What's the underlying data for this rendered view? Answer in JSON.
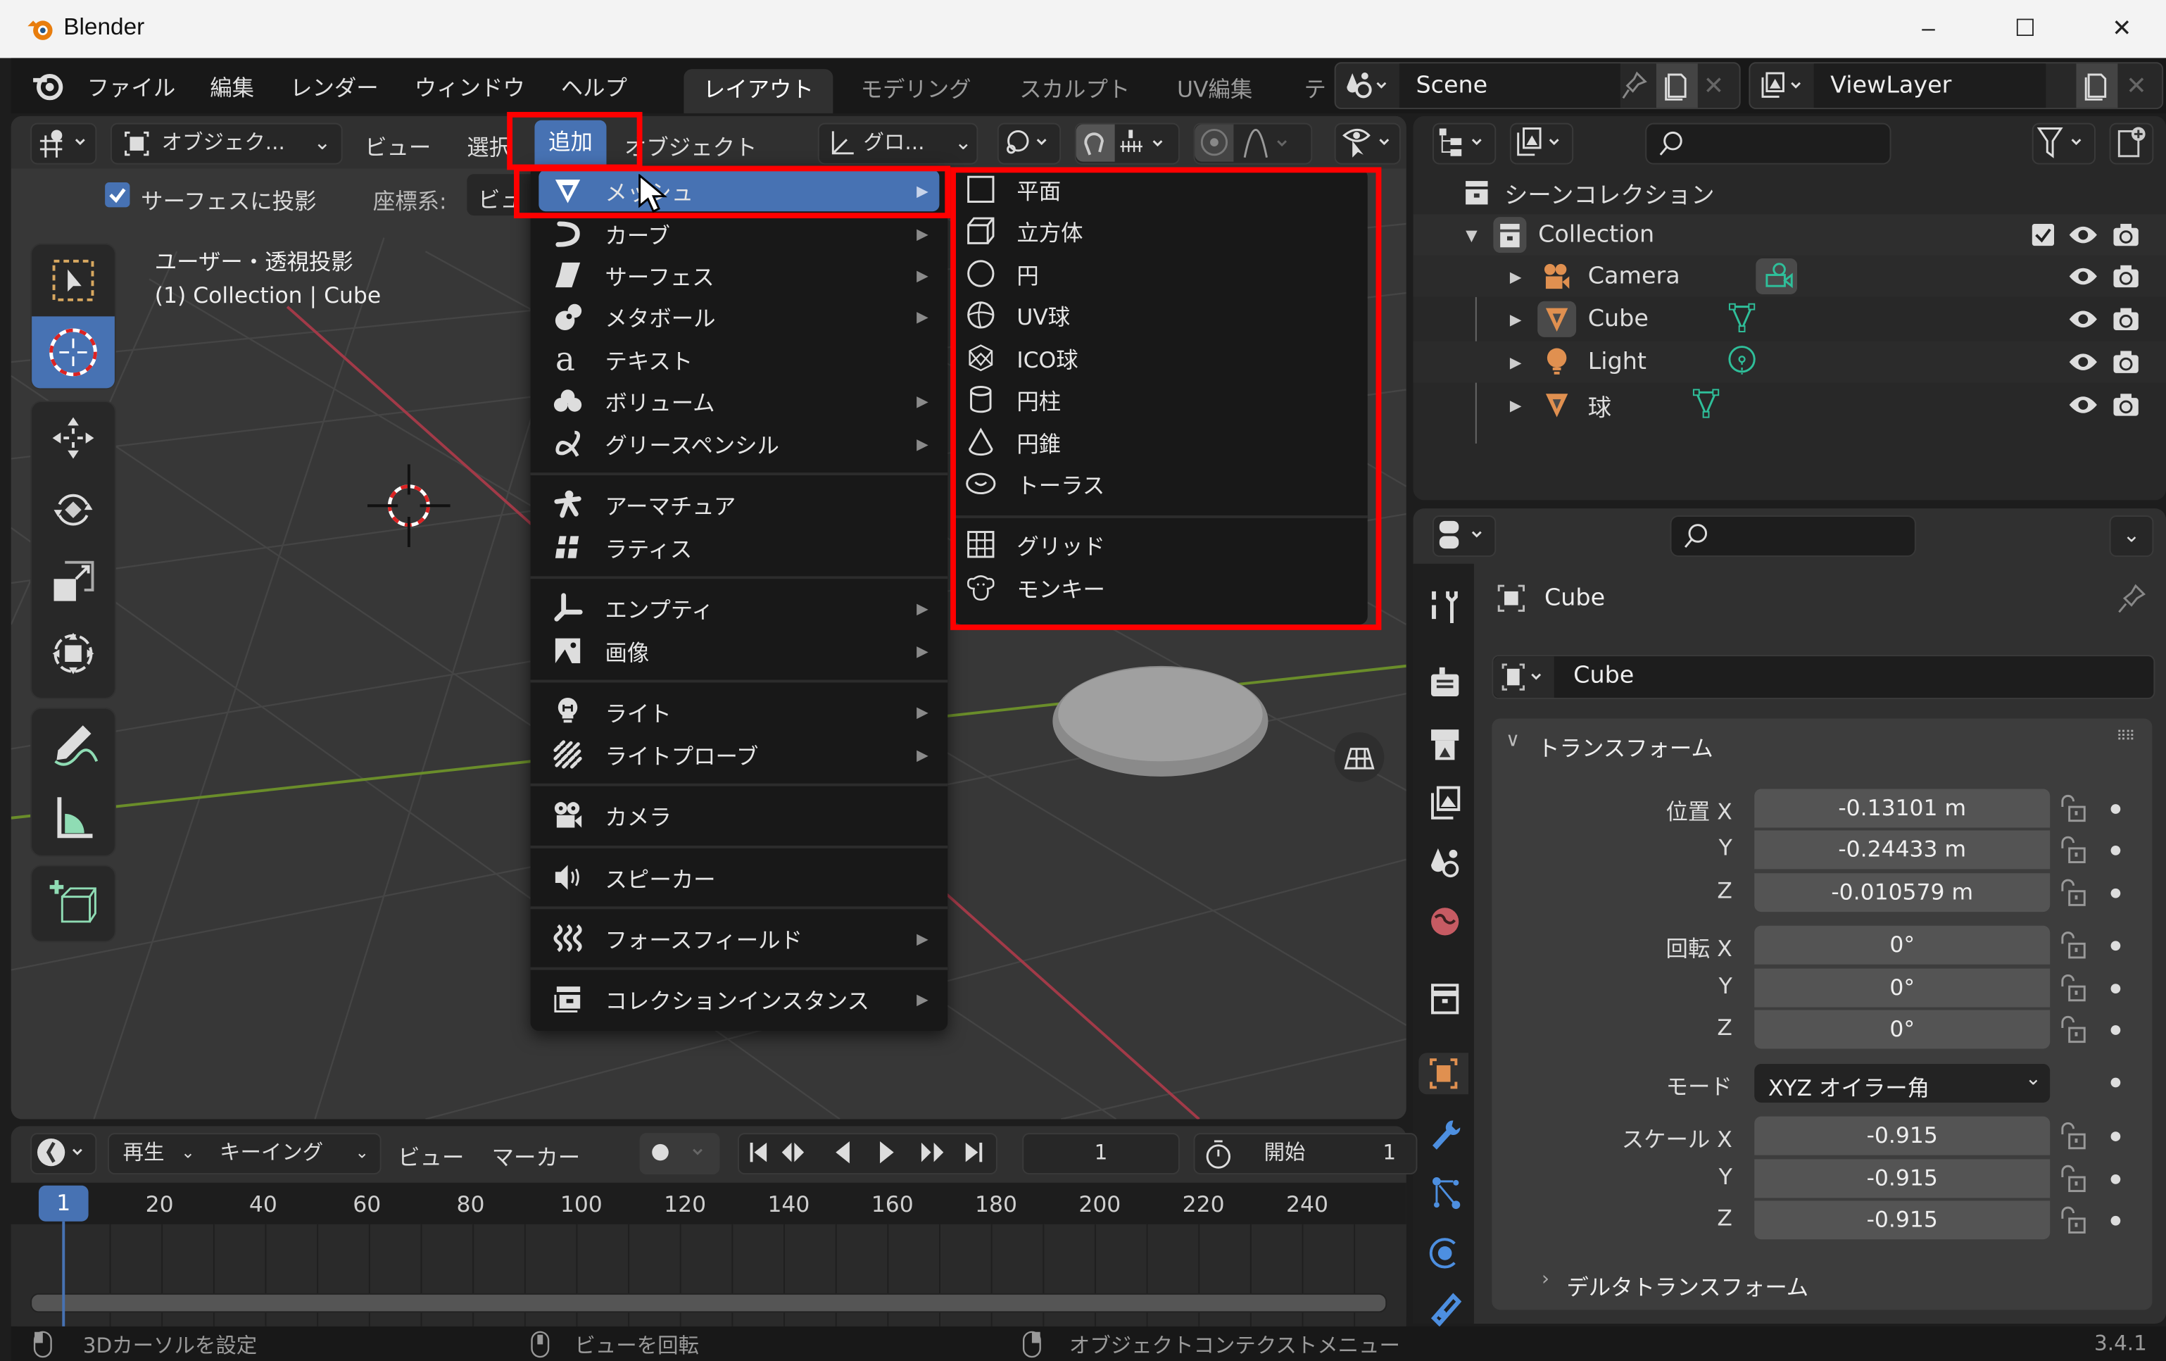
{
  "window": {
    "title": "Blender",
    "minimize": "–",
    "maximize": "☐",
    "close": "✕"
  },
  "topmenu": {
    "items": [
      "ファイル",
      "編集",
      "レンダー",
      "ウィンドウ",
      "ヘルプ"
    ],
    "workspaces": [
      "レイアウト",
      "モデリング",
      "スカルプト",
      "UV編集",
      "テ"
    ],
    "active_workspace": "レイアウト",
    "scene": "Scene",
    "view_layer": "ViewLayer"
  },
  "viewport_header": {
    "mode": "オブジェク...",
    "menus": [
      "ビュー",
      "選択",
      "追加",
      "オブジェクト"
    ],
    "active_menu": "追加",
    "orientation": "グロ...",
    "snap_surface_label": "サーフェスに投影",
    "snap_surface_checked": true,
    "coord_label": "座標系:",
    "coord_value": "ビュ"
  },
  "viewport": {
    "view_name": "ユーザー・透視投影",
    "object_info": "(1) Collection | Cube"
  },
  "add_menu": {
    "items": [
      {
        "label": "メッシュ",
        "icon": "mesh-icon",
        "submenu": true,
        "highlighted": true
      },
      {
        "label": "カーブ",
        "icon": "curve-icon",
        "submenu": true
      },
      {
        "label": "サーフェス",
        "icon": "surface-icon",
        "submenu": true
      },
      {
        "label": "メタボール",
        "icon": "metaball-icon",
        "submenu": true
      },
      {
        "label": "テキスト",
        "icon": "text-icon",
        "submenu": false
      },
      {
        "label": "ボリューム",
        "icon": "volume-icon",
        "submenu": true
      },
      {
        "label": "グリースペンシル",
        "icon": "grease-pencil-icon",
        "submenu": true
      },
      {
        "label": "アーマチュア",
        "icon": "armature-icon",
        "submenu": false
      },
      {
        "label": "ラティス",
        "icon": "lattice-icon",
        "submenu": false
      },
      {
        "label": "エンプティ",
        "icon": "empty-icon",
        "submenu": true
      },
      {
        "label": "画像",
        "icon": "image-icon",
        "submenu": true
      },
      {
        "label": "ライト",
        "icon": "light-icon",
        "submenu": true
      },
      {
        "label": "ライトプローブ",
        "icon": "light-probe-icon",
        "submenu": true
      },
      {
        "label": "カメラ",
        "icon": "camera-icon",
        "submenu": false
      },
      {
        "label": "スピーカー",
        "icon": "speaker-icon",
        "submenu": false
      },
      {
        "label": "フォースフィールド",
        "icon": "force-field-icon",
        "submenu": true
      },
      {
        "label": "コレクションインスタンス",
        "icon": "collection-instance-icon",
        "submenu": true
      }
    ]
  },
  "mesh_submenu": {
    "items": [
      {
        "label": "平面",
        "icon": "plane-icon"
      },
      {
        "label": "立方体",
        "icon": "cube-icon"
      },
      {
        "label": "円",
        "icon": "circle-icon"
      },
      {
        "label": "UV球",
        "icon": "uv-sphere-icon"
      },
      {
        "label": "ICO球",
        "icon": "ico-sphere-icon"
      },
      {
        "label": "円柱",
        "icon": "cylinder-icon"
      },
      {
        "label": "円錐",
        "icon": "cone-icon"
      },
      {
        "label": "トーラス",
        "icon": "torus-icon"
      },
      {
        "label": "グリッド",
        "icon": "grid-icon"
      },
      {
        "label": "モンキー",
        "icon": "monkey-icon"
      }
    ]
  },
  "outliner": {
    "root": "シーンコレクション",
    "collection": "Collection",
    "objects": [
      {
        "name": "Camera",
        "type": "camera"
      },
      {
        "name": "Cube",
        "type": "mesh"
      },
      {
        "name": "Light",
        "type": "light"
      },
      {
        "name": "球",
        "type": "mesh"
      }
    ]
  },
  "properties": {
    "object_name": "Cube",
    "name_field": "Cube",
    "panel_transform": "トランスフォーム",
    "location": {
      "label": "位置",
      "x": "-0.13101 m",
      "y": "-0.24433 m",
      "z": "-0.010579 m"
    },
    "rotation": {
      "label": "回転",
      "x": "0°",
      "y": "0°",
      "z": "0°"
    },
    "mode_label": "モード",
    "mode_value": "XYZ オイラー角",
    "scale": {
      "label": "スケール",
      "x": "-0.915",
      "y": "-0.915",
      "z": "-0.915"
    },
    "axes": [
      "X",
      "Y",
      "Z"
    ],
    "delta_transform": "デルタトランスフォーム"
  },
  "timeline": {
    "menus": [
      "再生",
      "キーイング",
      "ビュー",
      "マーカー"
    ],
    "current_frame": "1",
    "start_label": "開始",
    "start_value": "1",
    "playhead": "1",
    "ticks": [
      "20",
      "40",
      "60",
      "80",
      "100",
      "120",
      "140",
      "160",
      "180",
      "200",
      "220",
      "240"
    ]
  },
  "statusbar": {
    "left": "3Dカーソルを設定",
    "middle": "ビューを回転",
    "right": "オブジェクトコンテクストメニュー",
    "version": "3.4.1"
  },
  "colors": {
    "accent": "#4772b3",
    "highlight_box": "#ff0000",
    "object_orange": "#e09050",
    "data_green": "#2fbf9a"
  }
}
